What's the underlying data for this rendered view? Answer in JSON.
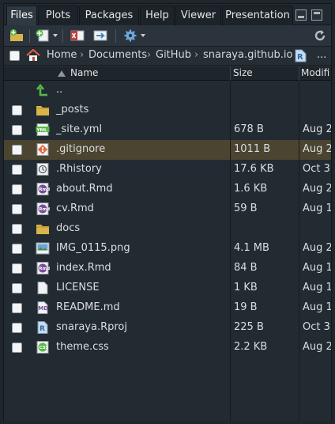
{
  "tabs": [
    {
      "label": "Files",
      "active": true
    },
    {
      "label": "Plots",
      "active": false
    },
    {
      "label": "Packages",
      "active": false
    },
    {
      "label": "Help",
      "active": false
    },
    {
      "label": "Viewer",
      "active": false
    },
    {
      "label": "Presentation",
      "active": false
    }
  ],
  "toolbar": {
    "icons": [
      "new-folder-icon",
      "new-file-icon",
      "delete-icon",
      "rename-icon",
      "gear-icon",
      "refresh-icon"
    ]
  },
  "path": {
    "home": "Home",
    "crumbs": [
      "Documents",
      "GitHub",
      "snaraya.github.io"
    ],
    "more": "..."
  },
  "columns": {
    "name": "Name",
    "size": "Size",
    "modified": "Modifi"
  },
  "files": [
    {
      "name": "..",
      "size": "",
      "modified": "",
      "icon": "up-arrow-icon",
      "checkbox": false,
      "selected": false
    },
    {
      "name": "_posts",
      "size": "",
      "modified": "",
      "icon": "folder-icon",
      "checkbox": true,
      "selected": false
    },
    {
      "name": "_site.yml",
      "size": "678 B",
      "modified": "Aug 2",
      "icon": "yml-file-icon",
      "checkbox": true,
      "selected": false
    },
    {
      "name": ".gitignore",
      "size": "1011 B",
      "modified": "Aug 2",
      "icon": "git-file-icon",
      "checkbox": true,
      "selected": true
    },
    {
      "name": ".Rhistory",
      "size": "17.6 KB",
      "modified": "Oct 3",
      "icon": "history-file-icon",
      "checkbox": true,
      "selected": false
    },
    {
      "name": "about.Rmd",
      "size": "1.6 KB",
      "modified": "Aug 2",
      "icon": "rmd-file-icon",
      "checkbox": true,
      "selected": false
    },
    {
      "name": "cv.Rmd",
      "size": "59 B",
      "modified": "Aug 1",
      "icon": "rmd-file-icon",
      "checkbox": true,
      "selected": false
    },
    {
      "name": "docs",
      "size": "",
      "modified": "",
      "icon": "folder-icon",
      "checkbox": true,
      "selected": false
    },
    {
      "name": "IMG_0115.png",
      "size": "4.1 MB",
      "modified": "Aug 2",
      "icon": "image-file-icon",
      "checkbox": true,
      "selected": false
    },
    {
      "name": "index.Rmd",
      "size": "84 B",
      "modified": "Aug 1",
      "icon": "rmd-file-icon",
      "checkbox": true,
      "selected": false
    },
    {
      "name": "LICENSE",
      "size": "1 KB",
      "modified": "Aug 1",
      "icon": "text-file-icon",
      "checkbox": true,
      "selected": false
    },
    {
      "name": "README.md",
      "size": "19 B",
      "modified": "Aug 1",
      "icon": "md-file-icon",
      "checkbox": true,
      "selected": false
    },
    {
      "name": "snaraya.Rproj",
      "size": "225 B",
      "modified": "Oct 3",
      "icon": "rproj-file-icon",
      "checkbox": true,
      "selected": false
    },
    {
      "name": "theme.css",
      "size": "2.2 KB",
      "modified": "Aug 2",
      "icon": "css-file-icon",
      "checkbox": true,
      "selected": false
    }
  ],
  "colors": {
    "accent_green": "#57b846",
    "folder": "#d9b44a",
    "selection": "#4a4431"
  }
}
